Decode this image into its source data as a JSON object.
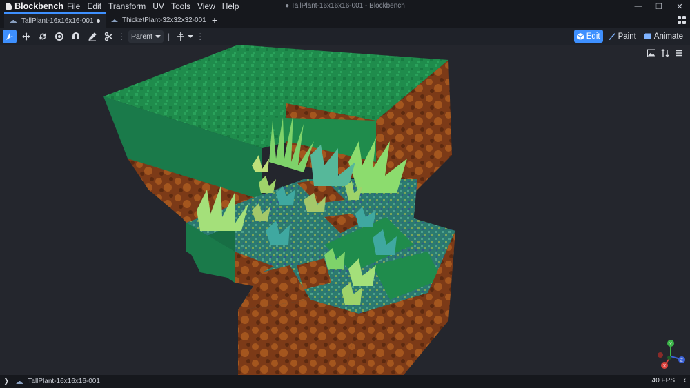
{
  "app": {
    "name": "Blockbench",
    "window_title": "● TallPlant-16x16x16-001 - Blockbench"
  },
  "menu": [
    "File",
    "Edit",
    "Transform",
    "UV",
    "Tools",
    "View",
    "Help"
  ],
  "tabs": [
    {
      "label": "TallPlant-16x16x16-001",
      "active": true,
      "unsaved": true
    },
    {
      "label": "ThicketPlant-32x32x32-001",
      "active": false
    }
  ],
  "new_tab_label": "+",
  "toolbar": {
    "pivot_select": "Parent",
    "tools": [
      "move-tool-icon",
      "resize-tool-icon",
      "rotate-tool-icon",
      "pivot-tool-icon",
      "vertex-snap-icon",
      "draw-tool-icon",
      "knife-tool-icon"
    ]
  },
  "modes": [
    {
      "label": "Edit",
      "active": true,
      "color": "#3e90ff"
    },
    {
      "label": "Paint",
      "active": false
    },
    {
      "label": "Animate",
      "active": false
    }
  ],
  "status": {
    "project": "TallPlant-16x16x16-001",
    "fps": "40 FPS"
  },
  "colors": {
    "accent": "#3e90ff",
    "grass_top": "#1e8a52",
    "dirt": "#7a3a18",
    "viewport_bg": "#24262d"
  }
}
